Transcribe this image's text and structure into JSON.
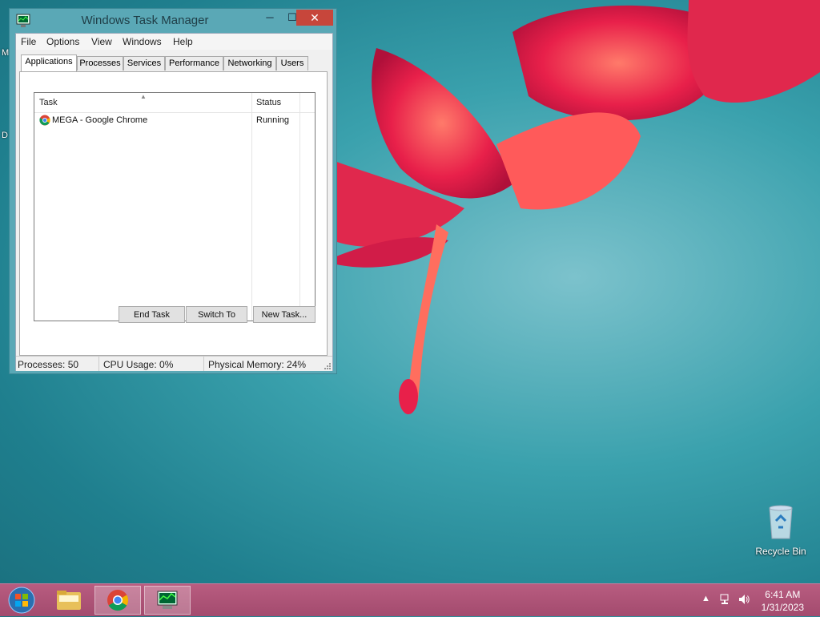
{
  "window": {
    "title": "Windows Task Manager",
    "minimize": "─",
    "maximize": "☐",
    "close": "✕"
  },
  "menu": [
    "File",
    "Options",
    "View",
    "Windows",
    "Help"
  ],
  "tabs": [
    "Applications",
    "Processes",
    "Services",
    "Performance",
    "Networking",
    "Users"
  ],
  "active_tab": "Applications",
  "tasks": {
    "columns": [
      "Task",
      "Status"
    ],
    "rows": [
      {
        "task": "MEGA - Google Chrome",
        "status": "Running",
        "icon": "chrome-icon"
      }
    ]
  },
  "buttons": {
    "end_task": "End Task",
    "switch_to": "Switch To",
    "new_task": "New Task..."
  },
  "status": {
    "processes": "Processes: 50",
    "cpu": "CPU Usage: 0%",
    "memory": "Physical Memory: 24%"
  },
  "desktop": {
    "edge_letters": [
      "M",
      "D"
    ],
    "recycle_bin": "Recycle Bin"
  },
  "taskbar": {
    "pinned": [
      "explorer-icon",
      "chrome-icon",
      "task-manager-icon"
    ],
    "time": "6:41 AM",
    "date": "1/31/2023"
  },
  "colors": {
    "taskbar": "#a34b6e",
    "close_button": "#c7463b",
    "wallpaper": "#3aa1ad"
  }
}
